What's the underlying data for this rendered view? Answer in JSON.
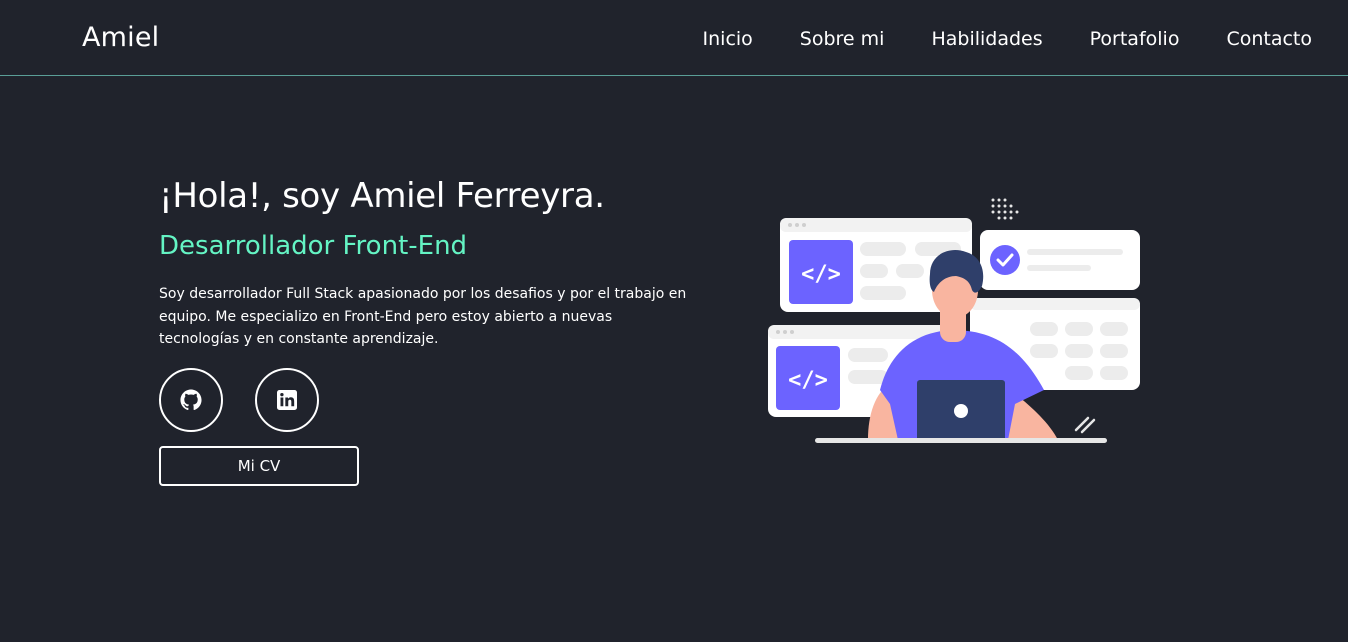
{
  "header": {
    "brand": "Amiel",
    "nav": [
      {
        "label": "Inicio"
      },
      {
        "label": "Sobre mi"
      },
      {
        "label": "Habilidades"
      },
      {
        "label": "Portafolio"
      },
      {
        "label": "Contacto"
      }
    ]
  },
  "hero": {
    "title": "¡Hola!, soy Amiel Ferreyra.",
    "subtitle": "Desarrollador Front-End",
    "description": "Soy desarrollador Full Stack apasionado por los desafios y por el trabajo en equipo. Me especializo en Front-End pero estoy abierto a nuevas tecnologías y en constante aprendizaje.",
    "social": [
      {
        "icon": "github-icon"
      },
      {
        "icon": "linkedin-icon"
      }
    ],
    "cv_label": "Mi CV",
    "illustration_icon": "developer-illustration"
  },
  "colors": {
    "background": "#20232c",
    "accent": "#64f4c4",
    "divider": "#5a9e97",
    "illustration_purple": "#6c63ff"
  }
}
